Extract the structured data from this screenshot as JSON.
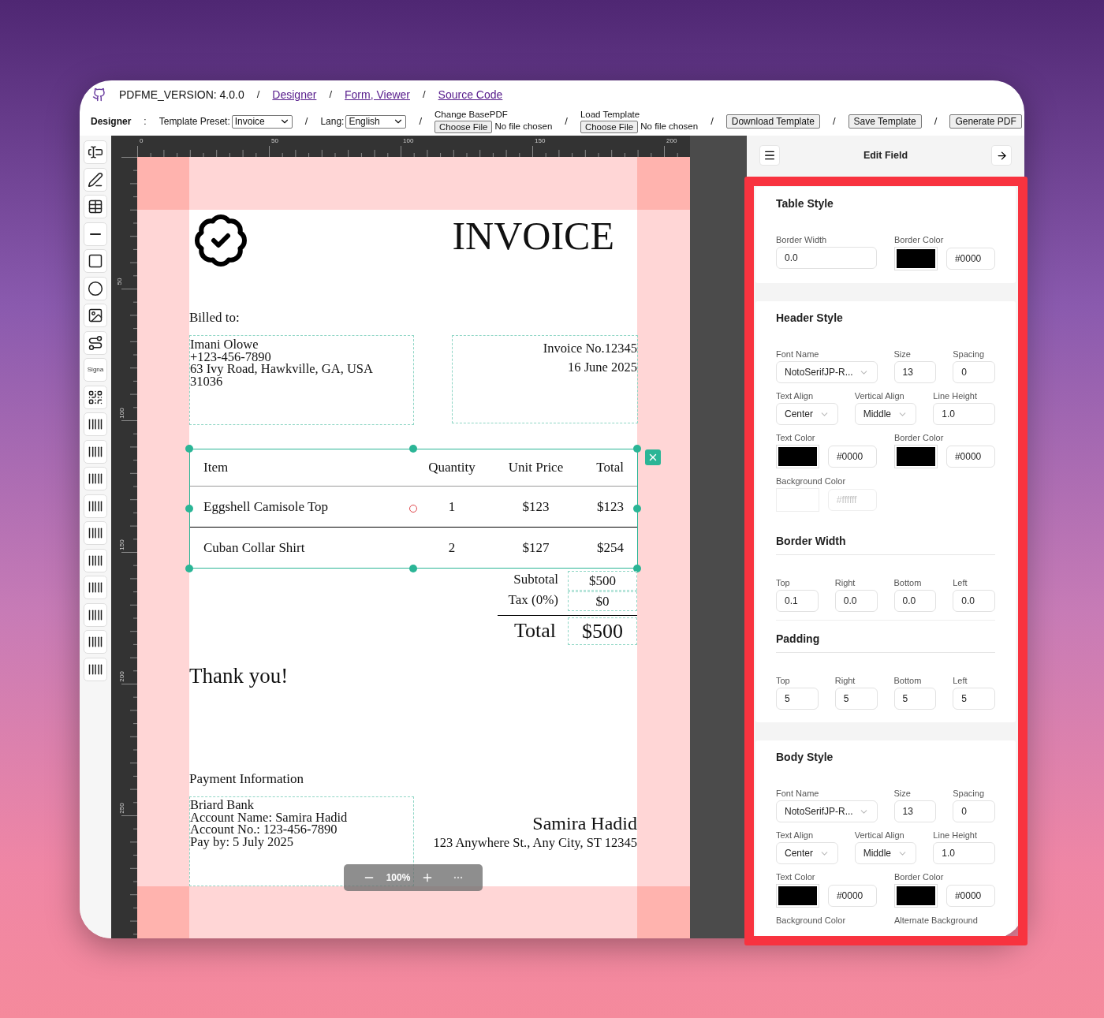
{
  "header": {
    "version": "PDFME_VERSION: 4.0.0",
    "links": [
      {
        "separator": "/",
        "label": "Designer"
      },
      {
        "separator": "/",
        "label": "Form, Viewer"
      },
      {
        "separator": "/",
        "label": "Source Code"
      }
    ]
  },
  "toolbar": {
    "title": "Designer",
    "title_separator": ":",
    "items": [
      {
        "kind": "select",
        "label": "Template Preset:",
        "value": "Invoice"
      },
      {
        "kind": "select",
        "separator": "/",
        "label": "Lang:",
        "value": "English"
      },
      {
        "kind": "file",
        "separator": "/",
        "label": "Change BasePDF",
        "button": "Choose File",
        "status": "No file chosen"
      },
      {
        "kind": "file",
        "separator": "/",
        "label": "Load Template",
        "button": "Choose File",
        "status": "No file chosen"
      },
      {
        "kind": "button",
        "separator": "/",
        "label": "Download Template"
      },
      {
        "kind": "button",
        "separator": "/",
        "label": "Save Template"
      },
      {
        "kind": "button",
        "separator": "/",
        "label": "Generate PDF"
      }
    ]
  },
  "tools": [
    {
      "kind": "text"
    },
    {
      "kind": "pen"
    },
    {
      "kind": "table"
    },
    {
      "kind": "line"
    },
    {
      "kind": "rectangle"
    },
    {
      "kind": "ellipse"
    },
    {
      "kind": "image"
    },
    {
      "kind": "svg"
    },
    {
      "kind": "label",
      "label": "Signa"
    },
    {
      "kind": "qrcode"
    },
    {
      "kind": "barcode"
    },
    {
      "kind": "barcode"
    },
    {
      "kind": "barcode"
    },
    {
      "kind": "barcode"
    },
    {
      "kind": "barcode"
    },
    {
      "kind": "barcode"
    },
    {
      "kind": "barcode"
    },
    {
      "kind": "barcode"
    },
    {
      "kind": "barcode"
    },
    {
      "kind": "barcode"
    }
  ],
  "rulers": {
    "horizontal": [
      "0",
      "50",
      "100",
      "150",
      "200"
    ],
    "vertical": [
      "50",
      "100",
      "150",
      "200",
      "250"
    ]
  },
  "page": {
    "title": "INVOICE",
    "billed_label": "Billed to:",
    "billed_lines": [
      "Imani Olowe",
      "+123-456-7890",
      "63 Ivy Road, Hawkville, GA, USA",
      "31036"
    ],
    "invoice_lines": [
      "Invoice No.12345",
      "16 June 2025"
    ],
    "table": {
      "columns": [
        "Item",
        "Quantity",
        "Unit Price",
        "Total"
      ],
      "rows": [
        [
          "Eggshell Camisole Top",
          "1",
          "$123",
          "$123"
        ],
        [
          "Cuban Collar Shirt",
          "2",
          "$127",
          "$254"
        ]
      ]
    },
    "summary": [
      {
        "label": "Subtotal",
        "value": "$500"
      },
      {
        "label": "Tax (0%)",
        "value": "$0"
      }
    ],
    "total": {
      "label": "Total",
      "value": "$500"
    },
    "thanks": "Thank you!",
    "payment_label": "Payment Information",
    "payment_lines": [
      "Briard Bank",
      "Account Name: Samira Hadid",
      "Account No.: 123-456-7890",
      "Pay by: 5 July 2025"
    ],
    "signer": {
      "name": "Samira Hadid",
      "address": "123 Anywhere St., Any City, ST 12345"
    }
  },
  "zoom": {
    "level_text": "100%"
  },
  "panel": {
    "title": "Edit Field",
    "sections": [
      {
        "title": "Table Style",
        "groups": [
          {
            "rows": [
              [
                {
                  "kind": "number",
                  "label": "Border Width",
                  "value": "0.0"
                },
                {
                  "kind": "color",
                  "label": "Border Color",
                  "color": "#000000",
                  "value": "#0000",
                  "disabled": false
                }
              ]
            ]
          }
        ]
      },
      {
        "title": "Header Style",
        "groups": [
          {
            "rows": [
              [
                {
                  "kind": "font",
                  "label": "Font Name",
                  "value": "NotoSerifJP-R..."
                },
                {
                  "kind": "number",
                  "label": "Size",
                  "value": "13"
                },
                {
                  "kind": "number",
                  "label": "Spacing",
                  "value": "0"
                }
              ],
              [
                {
                  "kind": "select",
                  "label": "Text Align",
                  "value": "Center"
                },
                {
                  "kind": "select",
                  "label": "Vertical Align",
                  "value": "Middle"
                },
                {
                  "kind": "number",
                  "label": "Line Height",
                  "value": "1.0"
                }
              ],
              [
                {
                  "kind": "color",
                  "label": "Text Color",
                  "color": "#000000",
                  "value": "#0000",
                  "disabled": false
                },
                {
                  "kind": "color",
                  "label": "Border Color",
                  "color": "#000000",
                  "value": "#0000",
                  "disabled": false
                }
              ],
              [
                {
                  "kind": "color",
                  "label": "Background Color",
                  "color": "#ffffff",
                  "value": "#ffffff",
                  "disabled": true
                }
              ]
            ]
          },
          {
            "heading": "Border Width",
            "rows": [
              [
                {
                  "kind": "number",
                  "label": "Top",
                  "value": "0.1"
                },
                {
                  "kind": "number",
                  "label": "Right",
                  "value": "0.0"
                },
                {
                  "kind": "number",
                  "label": "Bottom",
                  "value": "0.0"
                },
                {
                  "kind": "number",
                  "label": "Left",
                  "value": "0.0"
                }
              ]
            ]
          },
          {
            "heading": "Padding",
            "rows": [
              [
                {
                  "kind": "number",
                  "label": "Top",
                  "value": "5"
                },
                {
                  "kind": "number",
                  "label": "Right",
                  "value": "5"
                },
                {
                  "kind": "number",
                  "label": "Bottom",
                  "value": "5"
                },
                {
                  "kind": "number",
                  "label": "Left",
                  "value": "5"
                }
              ]
            ]
          }
        ]
      },
      {
        "title": "Body Style",
        "groups": [
          {
            "rows": [
              [
                {
                  "kind": "font",
                  "label": "Font Name",
                  "value": "NotoSerifJP-R..."
                },
                {
                  "kind": "number",
                  "label": "Size",
                  "value": "13"
                },
                {
                  "kind": "number",
                  "label": "Spacing",
                  "value": "0"
                }
              ],
              [
                {
                  "kind": "select",
                  "label": "Text Align",
                  "value": "Center"
                },
                {
                  "kind": "select",
                  "label": "Vertical Align",
                  "value": "Middle"
                },
                {
                  "kind": "number",
                  "label": "Line Height",
                  "value": "1.0"
                }
              ],
              [
                {
                  "kind": "color",
                  "label": "Text Color",
                  "color": "#000000",
                  "value": "#0000",
                  "disabled": false
                },
                {
                  "kind": "color",
                  "label": "Border Color",
                  "color": "#000000",
                  "value": "#0000",
                  "disabled": false
                }
              ],
              [
                {
                  "kind": "color",
                  "label": "Background Color"
                },
                {
                  "kind": "color",
                  "label": "Alternate Background"
                }
              ]
            ]
          }
        ]
      }
    ]
  }
}
